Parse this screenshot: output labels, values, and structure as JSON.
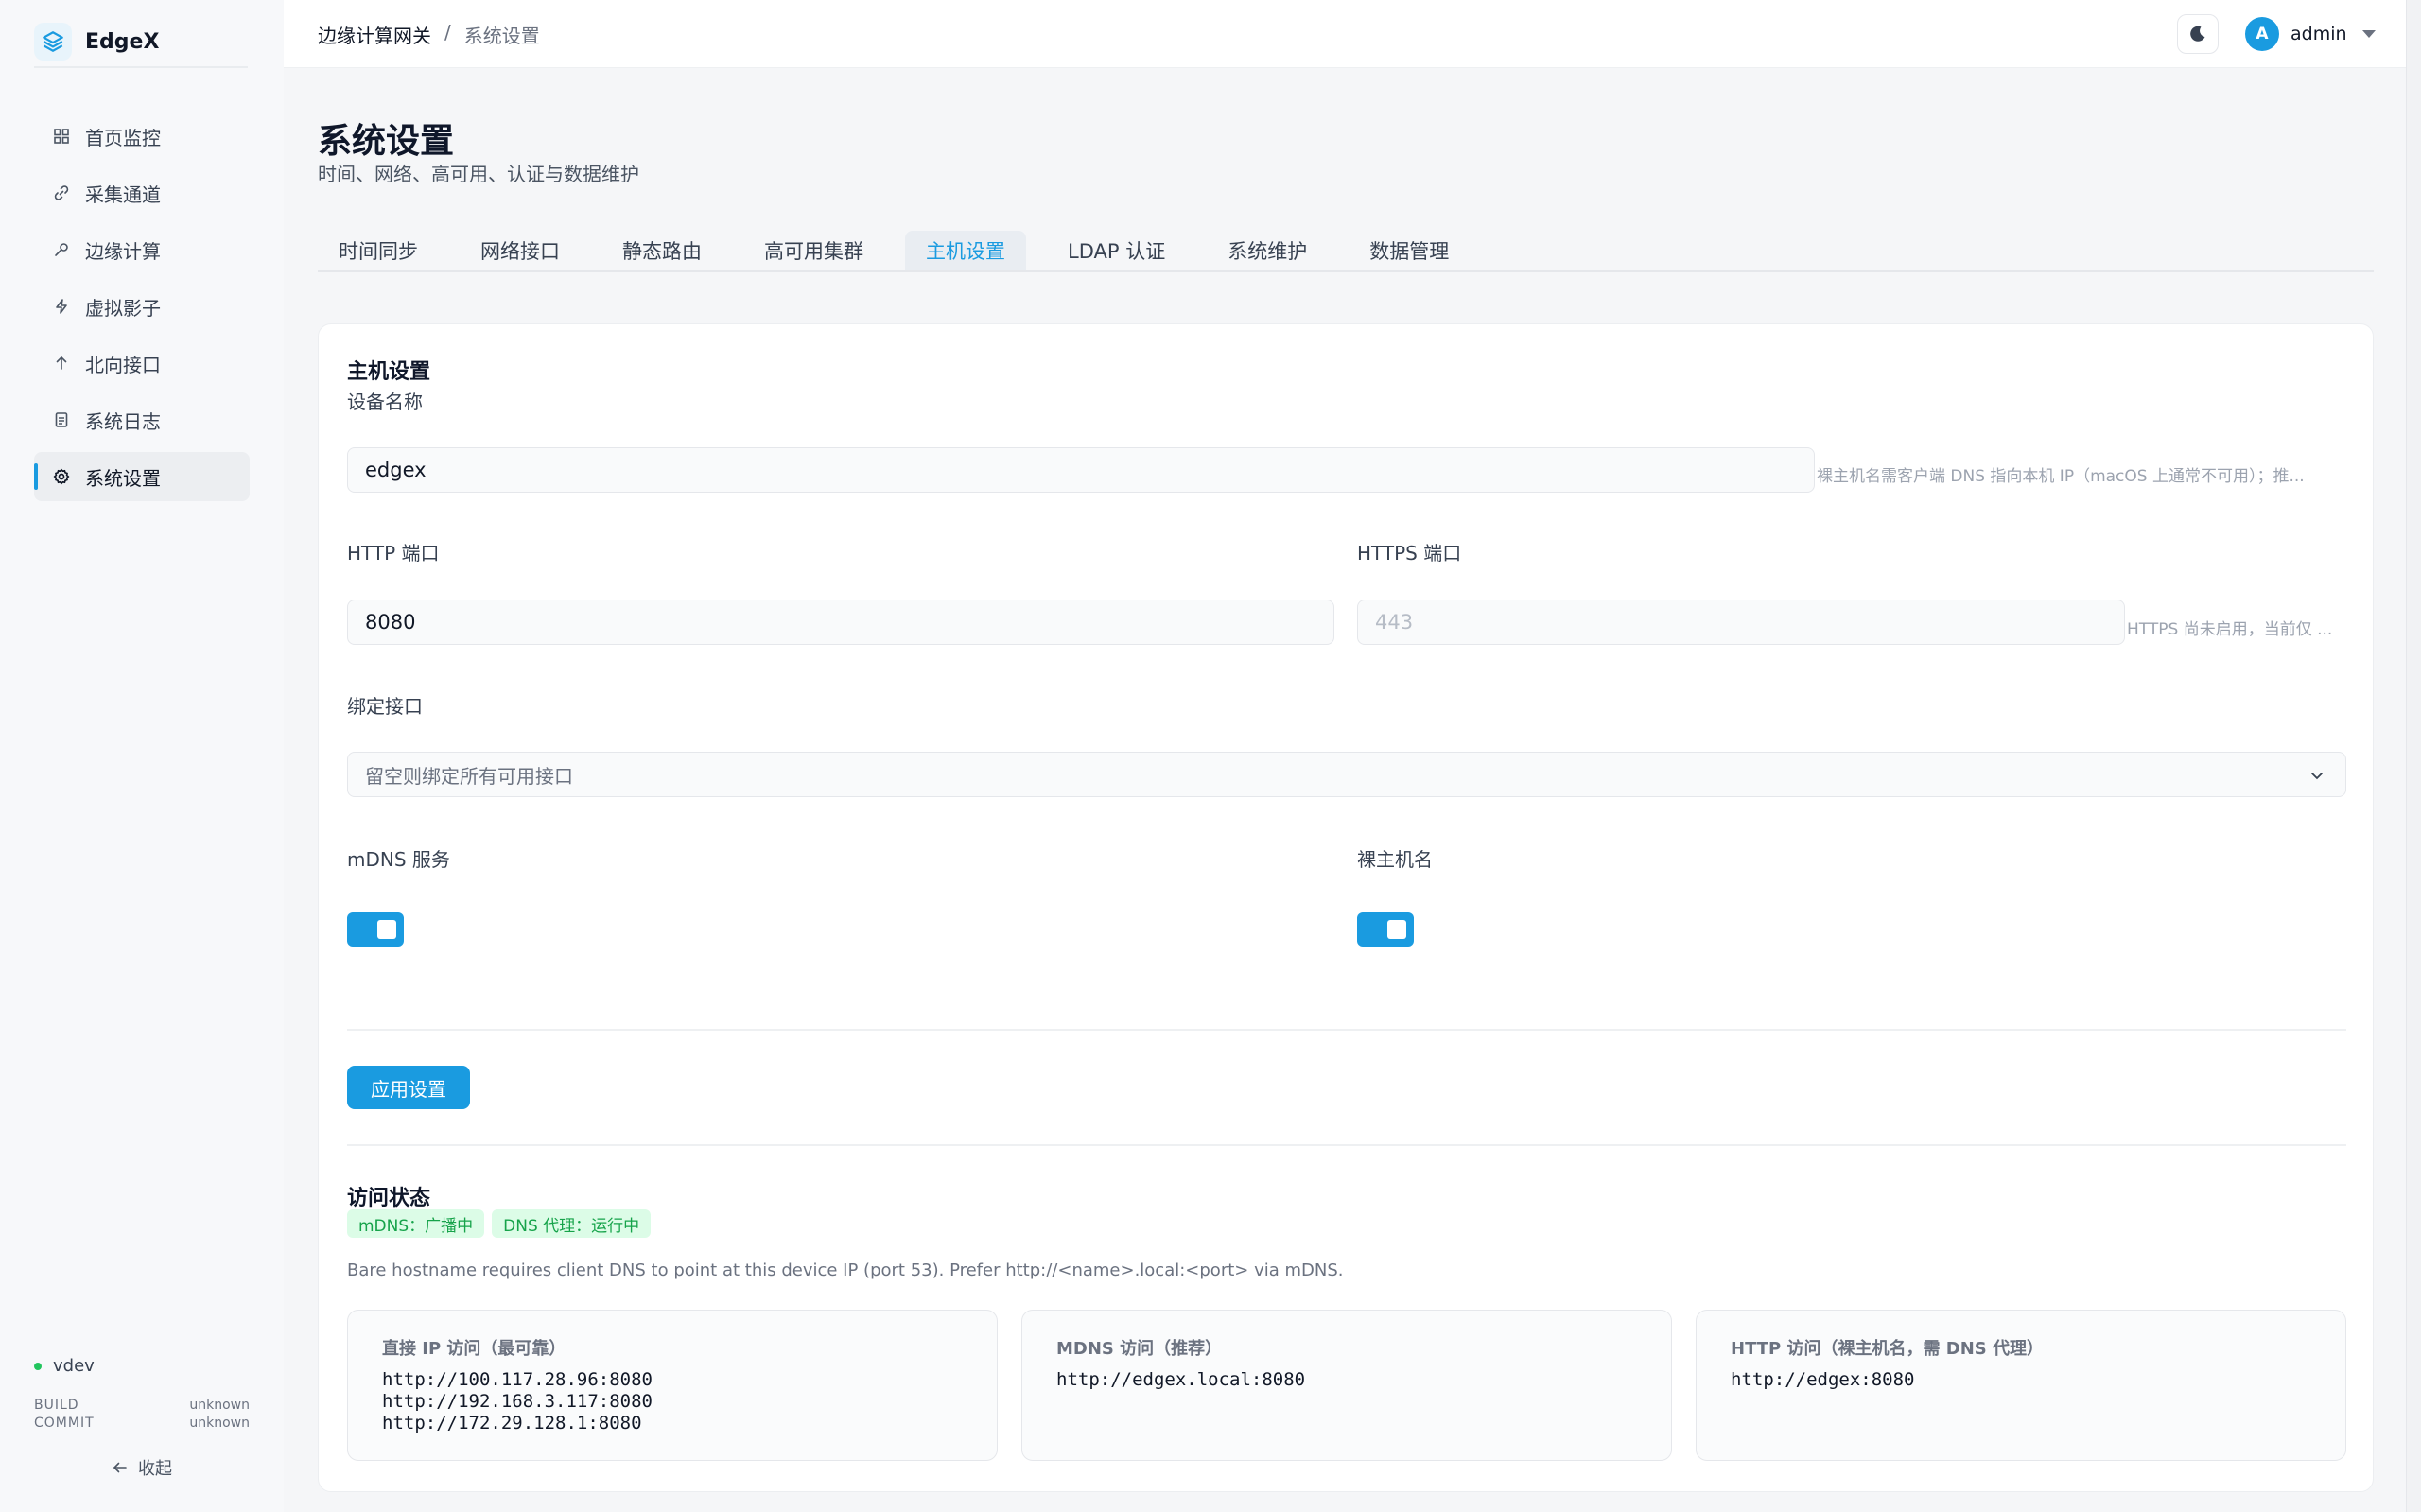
{
  "app": {
    "name": "EdgeX"
  },
  "sidebar": {
    "items": [
      {
        "label": "首页监控",
        "icon": "grid-icon"
      },
      {
        "label": "采集通道",
        "icon": "link-icon"
      },
      {
        "label": "边缘计算",
        "icon": "wrench-icon"
      },
      {
        "label": "虚拟影子",
        "icon": "bolt-icon"
      },
      {
        "label": "北向接口",
        "icon": "arrow-up-icon"
      },
      {
        "label": "系统日志",
        "icon": "document-icon"
      },
      {
        "label": "系统设置",
        "icon": "gear-icon",
        "active": true
      }
    ],
    "version": "vdev",
    "build_label": "BUILD",
    "commit_label": "COMMIT",
    "build_value": "unknown",
    "commit_value": "unknown",
    "collapse_label": "收起"
  },
  "topbar": {
    "breadcrumb": [
      "边缘计算网关",
      "系统设置"
    ],
    "breadcrumb_sep": "/",
    "user": {
      "initial": "A",
      "name": "admin"
    }
  },
  "page": {
    "title": "系统设置",
    "subtitle": "时间、网络、高可用、认证与数据维护"
  },
  "tabs": [
    {
      "label": "时间同步"
    },
    {
      "label": "网络接口"
    },
    {
      "label": "静态路由"
    },
    {
      "label": "高可用集群"
    },
    {
      "label": "主机设置",
      "active": true
    },
    {
      "label": "LDAP 认证"
    },
    {
      "label": "系统维护"
    },
    {
      "label": "数据管理"
    }
  ],
  "host": {
    "section_title": "主机设置",
    "device_name_label": "设备名称",
    "device_name_value": "edgex",
    "device_name_hint": "裸主机名需客户端 DNS 指向本机 IP（macOS 上通常不可用）；推...",
    "http_port_label": "HTTP 端口",
    "http_port_value": "8080",
    "https_port_label": "HTTPS 端口",
    "https_port_placeholder": "443",
    "https_port_hint": "HTTPS 尚未启用，当前仅 ...",
    "bind_label": "绑定接口",
    "bind_placeholder": "留空则绑定所有可用接口",
    "mdns_label": "mDNS 服务",
    "mdns_enabled": true,
    "bare_label": "裸主机名",
    "bare_enabled": true,
    "apply_label": "应用设置"
  },
  "access": {
    "title": "访问状态",
    "badges": [
      "mDNS：广播中",
      "DNS 代理：运行中"
    ],
    "note": "Bare hostname requires client DNS to point at this device IP (port 53). Prefer http://<name>.local:<port> via mDNS.",
    "cards": [
      {
        "title": "直接 IP 访问（最可靠）",
        "lines": [
          "http://100.117.28.96:8080",
          "http://192.168.3.117:8080",
          "http://172.29.128.1:8080"
        ]
      },
      {
        "title": "MDNS 访问（推荐）",
        "lines": [
          "http://edgex.local:8080"
        ]
      },
      {
        "title": "HTTP 访问（裸主机名，需 DNS 代理）",
        "lines": [
          "http://edgex:8080"
        ]
      }
    ]
  },
  "colors": {
    "accent": "#1a9be0",
    "success_bg": "#dcfce7",
    "success_text": "#16a34a"
  }
}
